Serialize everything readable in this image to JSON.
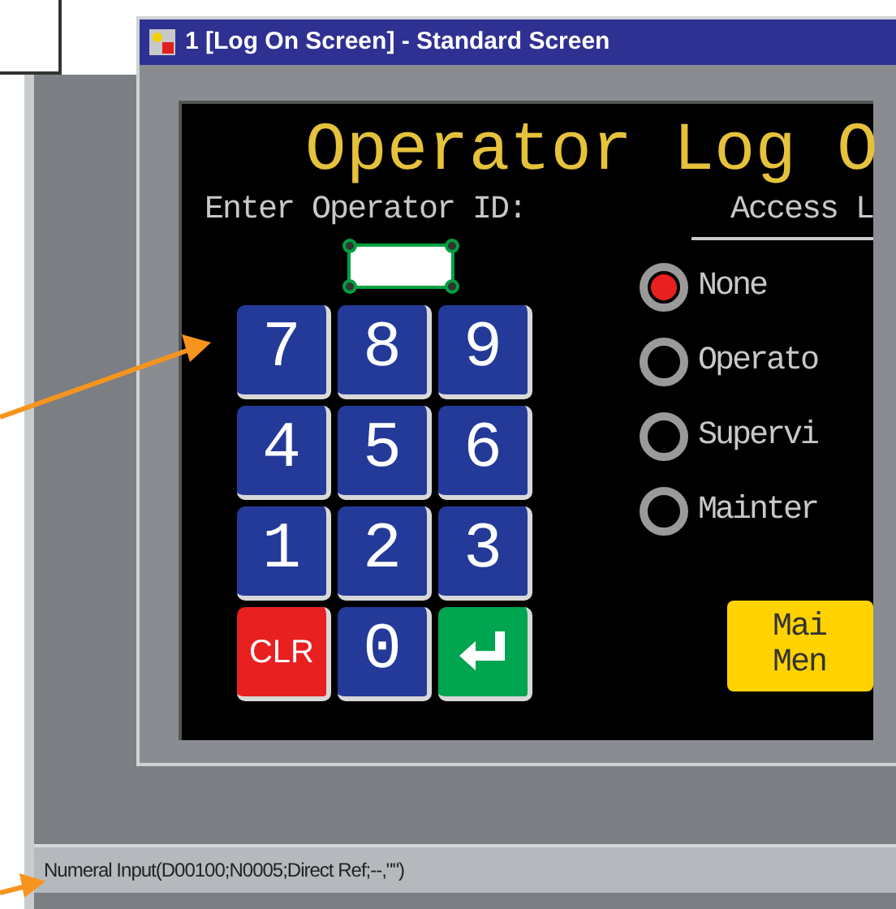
{
  "window": {
    "title": "1 [Log On Screen] - Standard Screen"
  },
  "screen": {
    "title": "Operator Log O",
    "id_entry": {
      "label": "Enter Operator ID:",
      "selected": true
    },
    "keypad": [
      {
        "kind": "digit",
        "label": "7"
      },
      {
        "kind": "digit",
        "label": "8"
      },
      {
        "kind": "digit",
        "label": "9"
      },
      {
        "kind": "digit",
        "label": "4"
      },
      {
        "kind": "digit",
        "label": "5"
      },
      {
        "kind": "digit",
        "label": "6"
      },
      {
        "kind": "digit",
        "label": "1"
      },
      {
        "kind": "digit",
        "label": "2"
      },
      {
        "kind": "digit",
        "label": "3"
      },
      {
        "kind": "clear",
        "label": "CLR"
      },
      {
        "kind": "digit",
        "label": "0"
      },
      {
        "kind": "enter"
      }
    ],
    "access_level": {
      "label": "Access L",
      "options": [
        {
          "label": "None",
          "selected": true
        },
        {
          "label": "Operato",
          "selected": false
        },
        {
          "label": "Supervi",
          "selected": false
        },
        {
          "label": "Mainter",
          "selected": false
        }
      ]
    },
    "menu_button": {
      "lines": [
        "Mai",
        "Men"
      ]
    }
  },
  "status_bar": "Numeral Input(D00100;N0005;Direct Ref;--,\"\")"
}
